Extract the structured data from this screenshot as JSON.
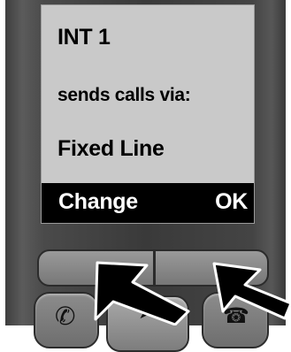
{
  "display": {
    "line1": "INT 1",
    "line2": "sends calls via:",
    "line3": "Fixed Line",
    "softkeys": {
      "left_label": "Change",
      "right_label": "OK"
    }
  },
  "colors": {
    "screen_bg": "#c9c9c9",
    "softkey_bar_bg": "#000000",
    "handset_body": "#3e3e3e",
    "arrow": "#000000"
  },
  "icons": {
    "talk_key": "phone-handset-icon",
    "nav_key": "navigation-arrow-icon",
    "end_key": "end-call-icon"
  }
}
